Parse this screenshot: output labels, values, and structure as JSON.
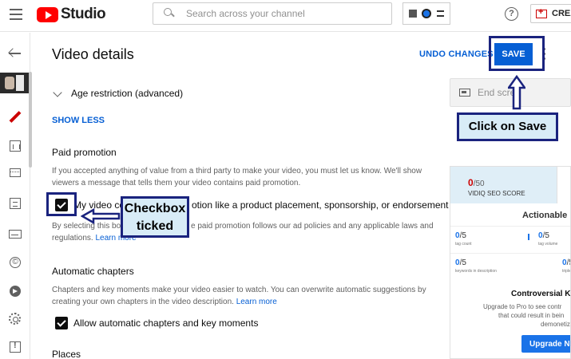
{
  "topbar": {
    "logo_text": "Studio",
    "search_placeholder": "Search across your channel",
    "create_label": "CREA"
  },
  "header": {
    "title": "Video details",
    "undo_label": "UNDO CHANGES",
    "save_label": "SAVE"
  },
  "sections": {
    "age_restriction": "Age restriction (advanced)",
    "show_less": "SHOW LESS",
    "paid_promotion": {
      "title": "Paid promotion",
      "description": "If you accepted anything of value from a third party to make your video, you must let us know. We'll show viewers a message that tells them your video contains paid promotion.",
      "checkbox_label_start": "My video co",
      "checkbox_label_end": "otion like a product placement, sponsorship, or endorsement",
      "checked": true,
      "note_start": "By selecting this bo",
      "note_mid": "e paid promotion follows our ad policies and any applicable laws and",
      "note_end": "regulations.",
      "learn_more": "Learn more"
    },
    "automatic_chapters": {
      "title": "Automatic chapters",
      "description": "Chapters and key moments make your video easier to watch. You can overwrite automatic suggestions by creating your own chapters in the video description.",
      "learn_more": "Learn more",
      "checkbox_label": "Allow automatic chapters and key moments",
      "checked": true
    },
    "places": {
      "title": "Places"
    }
  },
  "right_panel": {
    "end_screen_label": "End scre",
    "vidiq": {
      "score": "0",
      "score_max": "/50",
      "seo_label": "VIDIQ SEO SCORE",
      "actionable": "Actionable",
      "metrics": [
        {
          "value": "0",
          "max": "/5",
          "label": "tag count"
        },
        {
          "value": "0",
          "max": "/5",
          "label": "tag volume"
        },
        {
          "value": "0",
          "max": "/5",
          "label": "keywords in description"
        },
        {
          "value": "0",
          "max": "/5",
          "label": "triple"
        }
      ],
      "controversial": "Controversial Ke",
      "upgrade_line1": "Upgrade to Pro to see contr",
      "upgrade_line2": "that could result in bein",
      "upgrade_line3": "demonetiz",
      "upgrade_button": "Upgrade No"
    }
  },
  "annotations": {
    "click_on_save": "Click on Save",
    "checkbox_ticked_line1": "Checkbox",
    "checkbox_ticked_line2": "ticked",
    "color": "#1a237e",
    "fill": "#d8ecf7"
  },
  "colors": {
    "accent": "#065fd4",
    "brand_red": "#ff0000"
  }
}
